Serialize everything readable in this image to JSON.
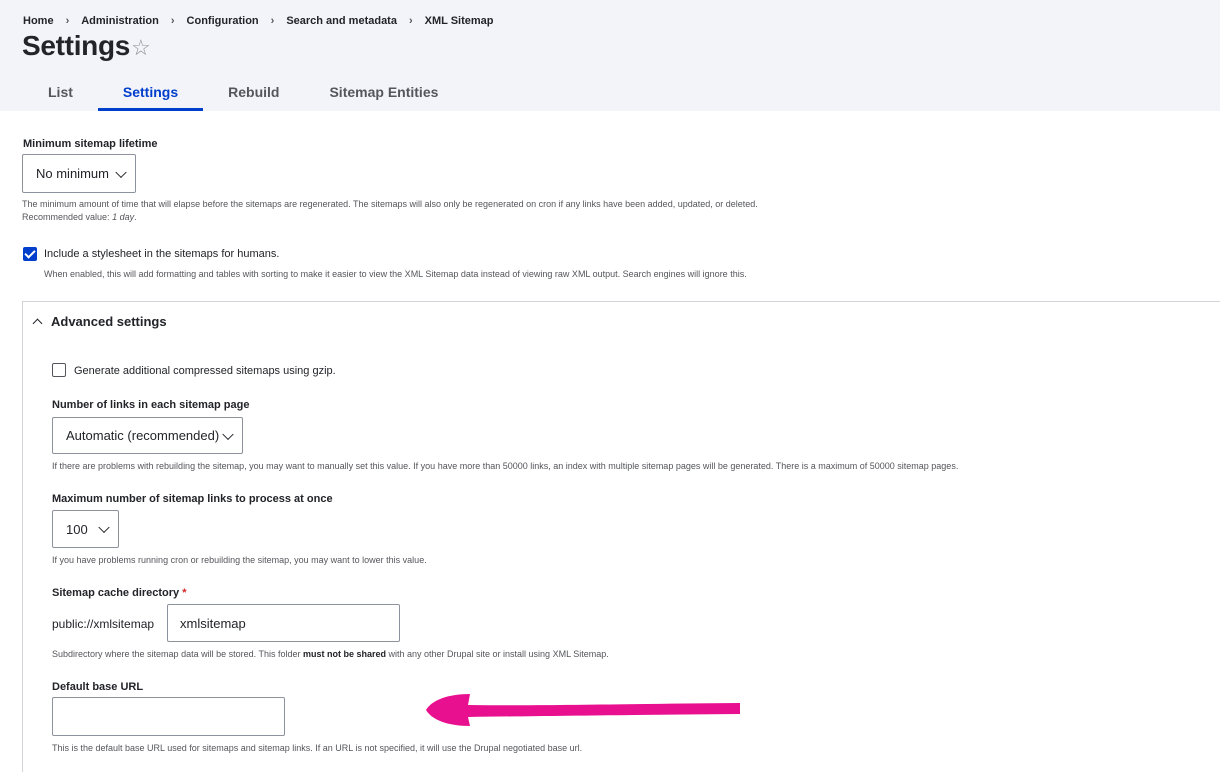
{
  "breadcrumb": [
    "Home",
    "Administration",
    "Configuration",
    "Search and metadata",
    "XML Sitemap"
  ],
  "page_title": "Settings",
  "tabs": [
    "List",
    "Settings",
    "Rebuild",
    "Sitemap Entities"
  ],
  "active_tab": "Settings",
  "min_lifetime": {
    "label": "Minimum sitemap lifetime",
    "value": "No minimum",
    "description": "The minimum amount of time that will elapse before the sitemaps are regenerated. The sitemaps will also only be regenerated on cron if any links have been added, updated, or deleted.",
    "recommended_prefix": "Recommended value: ",
    "recommended_value": "1 day",
    "recommended_suffix": "."
  },
  "stylesheet": {
    "label": "Include a stylesheet in the sitemaps for humans.",
    "checked": true,
    "description": "When enabled, this will add formatting and tables with sorting to make it easier to view the XML Sitemap data instead of viewing raw XML output. Search engines will ignore this."
  },
  "advanced": {
    "summary": "Advanced settings",
    "gzip": {
      "label": "Generate additional compressed sitemaps using gzip.",
      "checked": false
    },
    "links_per_page": {
      "label": "Number of links in each sitemap page",
      "value": "Automatic (recommended)",
      "description": "If there are problems with rebuilding the sitemap, you may want to manually set this value. If you have more than 50000 links, an index with multiple sitemap pages will be generated. There is a maximum of 50000 sitemap pages."
    },
    "batch_limit": {
      "label": "Maximum number of sitemap links to process at once",
      "value": "100",
      "description": "If you have problems running cron or rebuilding the sitemap, you may want to lower this value."
    },
    "cache_dir": {
      "label": "Sitemap cache directory",
      "required_mark": "*",
      "prefix": "public://xmlsitemap",
      "value": "xmlsitemap",
      "description_before": "Subdirectory where the sitemap data will be stored. This folder ",
      "description_bold": "must not be shared",
      "description_after": " with any other Drupal site or install using XML Sitemap."
    },
    "base_url": {
      "label": "Default base URL",
      "value": "",
      "description": "This is the default base URL used for sitemaps and sitemap links. If an URL is not specified, it will use the Drupal negotiated base url."
    }
  },
  "colors": {
    "accent": "#003ecc",
    "annotation_arrow": "#e8108f"
  }
}
